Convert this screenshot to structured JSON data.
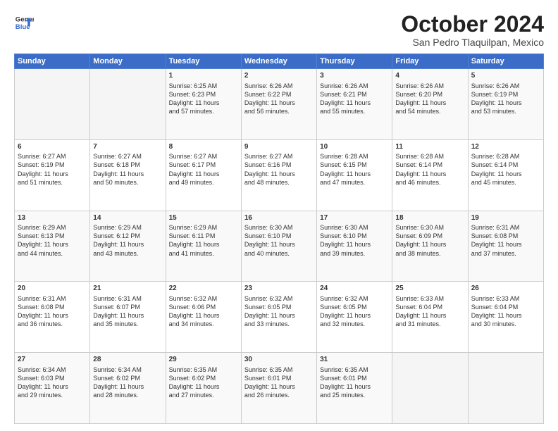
{
  "header": {
    "logo_line1": "General",
    "logo_line2": "Blue",
    "month": "October 2024",
    "location": "San Pedro Tlaquilpan, Mexico"
  },
  "days_of_week": [
    "Sunday",
    "Monday",
    "Tuesday",
    "Wednesday",
    "Thursday",
    "Friday",
    "Saturday"
  ],
  "weeks": [
    [
      {
        "day": "",
        "data": ""
      },
      {
        "day": "",
        "data": ""
      },
      {
        "day": "1",
        "data": "Sunrise: 6:25 AM\nSunset: 6:23 PM\nDaylight: 11 hours\nand 57 minutes."
      },
      {
        "day": "2",
        "data": "Sunrise: 6:26 AM\nSunset: 6:22 PM\nDaylight: 11 hours\nand 56 minutes."
      },
      {
        "day": "3",
        "data": "Sunrise: 6:26 AM\nSunset: 6:21 PM\nDaylight: 11 hours\nand 55 minutes."
      },
      {
        "day": "4",
        "data": "Sunrise: 6:26 AM\nSunset: 6:20 PM\nDaylight: 11 hours\nand 54 minutes."
      },
      {
        "day": "5",
        "data": "Sunrise: 6:26 AM\nSunset: 6:19 PM\nDaylight: 11 hours\nand 53 minutes."
      }
    ],
    [
      {
        "day": "6",
        "data": "Sunrise: 6:27 AM\nSunset: 6:19 PM\nDaylight: 11 hours\nand 51 minutes."
      },
      {
        "day": "7",
        "data": "Sunrise: 6:27 AM\nSunset: 6:18 PM\nDaylight: 11 hours\nand 50 minutes."
      },
      {
        "day": "8",
        "data": "Sunrise: 6:27 AM\nSunset: 6:17 PM\nDaylight: 11 hours\nand 49 minutes."
      },
      {
        "day": "9",
        "data": "Sunrise: 6:27 AM\nSunset: 6:16 PM\nDaylight: 11 hours\nand 48 minutes."
      },
      {
        "day": "10",
        "data": "Sunrise: 6:28 AM\nSunset: 6:15 PM\nDaylight: 11 hours\nand 47 minutes."
      },
      {
        "day": "11",
        "data": "Sunrise: 6:28 AM\nSunset: 6:14 PM\nDaylight: 11 hours\nand 46 minutes."
      },
      {
        "day": "12",
        "data": "Sunrise: 6:28 AM\nSunset: 6:14 PM\nDaylight: 11 hours\nand 45 minutes."
      }
    ],
    [
      {
        "day": "13",
        "data": "Sunrise: 6:29 AM\nSunset: 6:13 PM\nDaylight: 11 hours\nand 44 minutes."
      },
      {
        "day": "14",
        "data": "Sunrise: 6:29 AM\nSunset: 6:12 PM\nDaylight: 11 hours\nand 43 minutes."
      },
      {
        "day": "15",
        "data": "Sunrise: 6:29 AM\nSunset: 6:11 PM\nDaylight: 11 hours\nand 41 minutes."
      },
      {
        "day": "16",
        "data": "Sunrise: 6:30 AM\nSunset: 6:10 PM\nDaylight: 11 hours\nand 40 minutes."
      },
      {
        "day": "17",
        "data": "Sunrise: 6:30 AM\nSunset: 6:10 PM\nDaylight: 11 hours\nand 39 minutes."
      },
      {
        "day": "18",
        "data": "Sunrise: 6:30 AM\nSunset: 6:09 PM\nDaylight: 11 hours\nand 38 minutes."
      },
      {
        "day": "19",
        "data": "Sunrise: 6:31 AM\nSunset: 6:08 PM\nDaylight: 11 hours\nand 37 minutes."
      }
    ],
    [
      {
        "day": "20",
        "data": "Sunrise: 6:31 AM\nSunset: 6:08 PM\nDaylight: 11 hours\nand 36 minutes."
      },
      {
        "day": "21",
        "data": "Sunrise: 6:31 AM\nSunset: 6:07 PM\nDaylight: 11 hours\nand 35 minutes."
      },
      {
        "day": "22",
        "data": "Sunrise: 6:32 AM\nSunset: 6:06 PM\nDaylight: 11 hours\nand 34 minutes."
      },
      {
        "day": "23",
        "data": "Sunrise: 6:32 AM\nSunset: 6:05 PM\nDaylight: 11 hours\nand 33 minutes."
      },
      {
        "day": "24",
        "data": "Sunrise: 6:32 AM\nSunset: 6:05 PM\nDaylight: 11 hours\nand 32 minutes."
      },
      {
        "day": "25",
        "data": "Sunrise: 6:33 AM\nSunset: 6:04 PM\nDaylight: 11 hours\nand 31 minutes."
      },
      {
        "day": "26",
        "data": "Sunrise: 6:33 AM\nSunset: 6:04 PM\nDaylight: 11 hours\nand 30 minutes."
      }
    ],
    [
      {
        "day": "27",
        "data": "Sunrise: 6:34 AM\nSunset: 6:03 PM\nDaylight: 11 hours\nand 29 minutes."
      },
      {
        "day": "28",
        "data": "Sunrise: 6:34 AM\nSunset: 6:02 PM\nDaylight: 11 hours\nand 28 minutes."
      },
      {
        "day": "29",
        "data": "Sunrise: 6:35 AM\nSunset: 6:02 PM\nDaylight: 11 hours\nand 27 minutes."
      },
      {
        "day": "30",
        "data": "Sunrise: 6:35 AM\nSunset: 6:01 PM\nDaylight: 11 hours\nand 26 minutes."
      },
      {
        "day": "31",
        "data": "Sunrise: 6:35 AM\nSunset: 6:01 PM\nDaylight: 11 hours\nand 25 minutes."
      },
      {
        "day": "",
        "data": ""
      },
      {
        "day": "",
        "data": ""
      }
    ]
  ]
}
